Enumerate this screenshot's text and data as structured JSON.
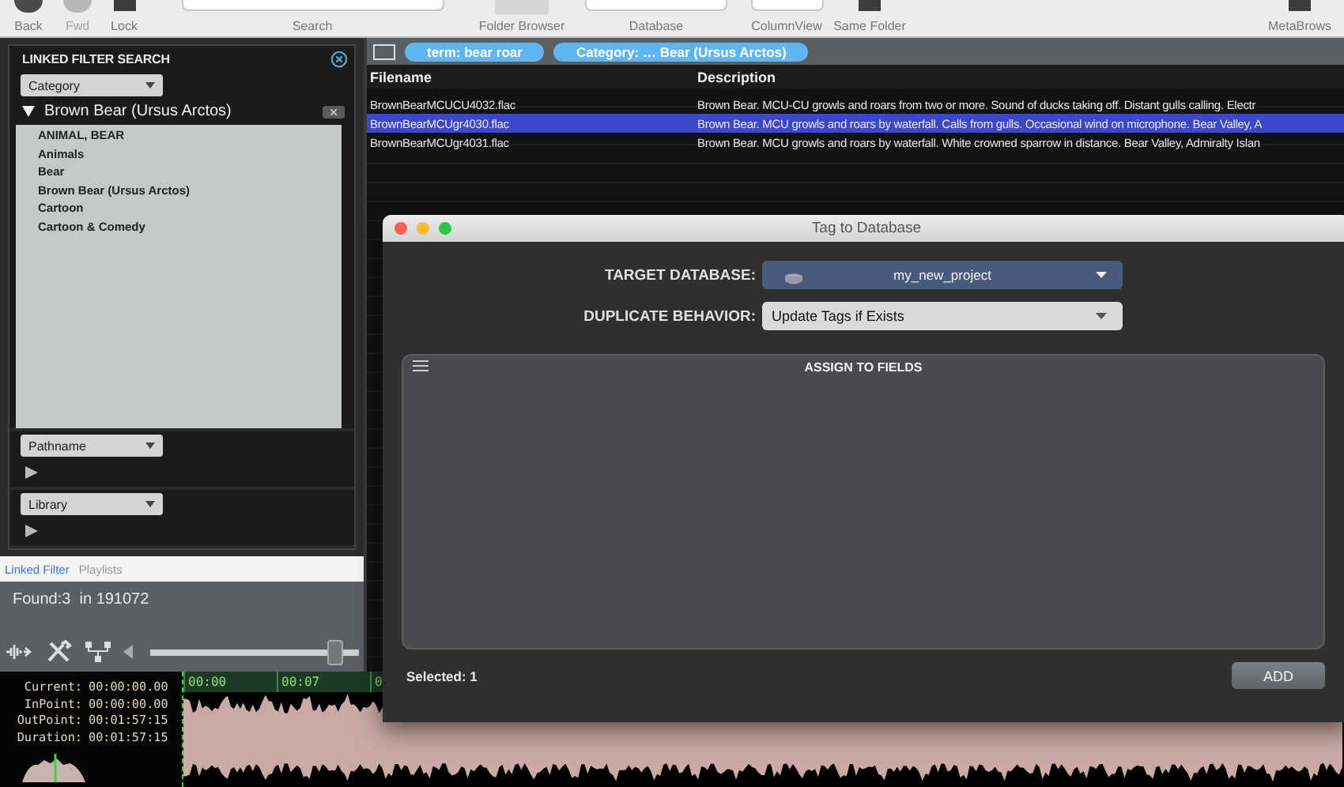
{
  "toolbar": {
    "items": [
      {
        "label": "Back",
        "kind": "circle",
        "disabled": false
      },
      {
        "label": "Fwd",
        "kind": "circle",
        "disabled": true
      },
      {
        "label": "Lock",
        "kind": "glyph",
        "disabled": false
      },
      {
        "label": "Search",
        "kind": "field",
        "disabled": false
      },
      {
        "label": "Folder Browser",
        "kind": "tile",
        "disabled": false
      },
      {
        "label": "Database",
        "kind": "field",
        "disabled": false
      },
      {
        "label": "ColumnView",
        "kind": "field",
        "disabled": false
      },
      {
        "label": "Same Folder",
        "kind": "glyph",
        "disabled": false
      },
      {
        "label": "MetaBrows",
        "kind": "glyph",
        "disabled": false
      }
    ]
  },
  "filter_panel": {
    "title": "LINKED FILTER SEARCH",
    "filters": [
      {
        "dropdown": "Category",
        "expanded": true,
        "header": "Brown Bear (Ursus Arctos)",
        "items": [
          "ANIMAL, BEAR",
          "Animals",
          "Bear",
          "Brown Bear (Ursus Arctos)",
          "Cartoon",
          "Cartoon & Comedy"
        ]
      },
      {
        "dropdown": "Pathname",
        "expanded": false
      },
      {
        "dropdown": "Library",
        "expanded": false
      }
    ]
  },
  "tabs": [
    {
      "label": "Linked Filter",
      "selected": true
    },
    {
      "label": "Playlists",
      "selected": false
    }
  ],
  "status": "Found:3  in 191072",
  "player": {
    "slider": {
      "level": 0.92
    }
  },
  "timecode": [
    {
      "label": "Current:",
      "value": "00:00:00.00"
    },
    {
      "label": "InPoint:",
      "value": "00:00:00.00"
    },
    {
      "label": "OutPoint:",
      "value": "00:01:57:15"
    },
    {
      "label": "Duration:",
      "value": "00:01:57:15"
    }
  ],
  "ruler": [
    "00:00",
    "00:07",
    "0"
  ],
  "search_terms": [
    "term: bear roar",
    "Category: … Bear (Ursus Arctos)"
  ],
  "table": {
    "columns": [
      "Filename",
      "Description"
    ],
    "rows": [
      {
        "cells": [
          "BrownBearMCUCU4032.flac",
          "Brown Bear. MCU-CU growls and roars from two or more. Sound of ducks taking off. Distant gulls calling. Electr"
        ],
        "selected": false
      },
      {
        "cells": [
          "BrownBearMCUgr4030.flac",
          "Brown Bear. MCU growls and roars by waterfall. Calls from gulls. Occasional wind on microphone. Bear Valley, A"
        ],
        "selected": true
      },
      {
        "cells": [
          "BrownBearMCUgr4031.flac",
          "Brown Bear. MCU growls and roars by waterfall. White crowned sparrow in distance. Bear Valley, Admiralty Islan"
        ],
        "selected": false
      }
    ]
  },
  "dialog": {
    "title": "Tag to Database",
    "fields": [
      {
        "label": "TARGET DATABASE:",
        "value": "my_new_project",
        "kind": "database"
      },
      {
        "label": "DUPLICATE BEHAVIOR:",
        "value": "Update Tags if Exists",
        "kind": "plain"
      }
    ],
    "panel_title": "ASSIGN TO FIELDS",
    "footer": "Selected: 1",
    "button": "ADD"
  }
}
